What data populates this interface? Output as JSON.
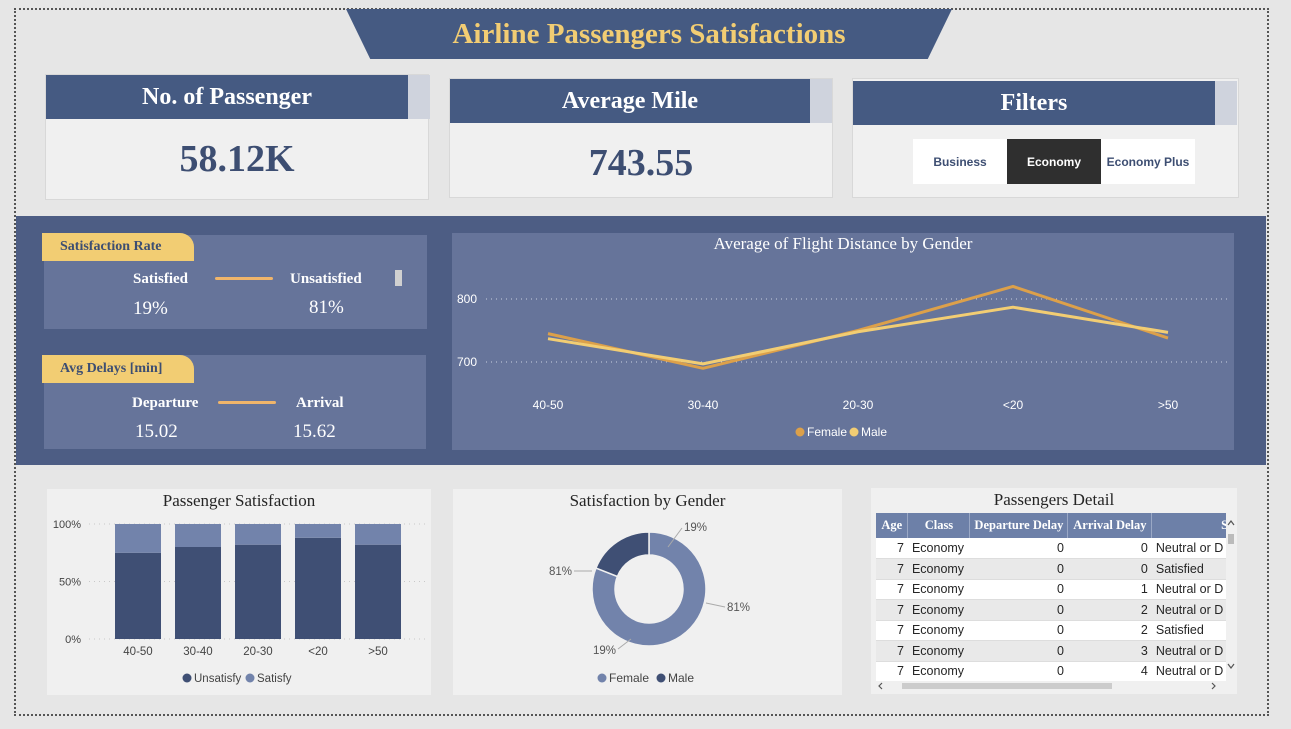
{
  "title": "Airline Passengers Satisfactions",
  "kpis": {
    "passengers": {
      "label": "No. of Passenger",
      "value": "58.12K"
    },
    "mile": {
      "label": "Average Mile",
      "value": "743.55"
    },
    "filters": {
      "label": "Filters",
      "options": [
        "Business",
        "Economy",
        "Economy Plus"
      ],
      "selected": "Economy"
    }
  },
  "satisfaction_rate": {
    "tag": "Satisfaction Rate",
    "left_label": "Satisfied",
    "left_value": "19%",
    "right_label": "Unsatisfied",
    "right_value": "81%"
  },
  "delays": {
    "tag": "Avg Delays [min]",
    "left_label": "Departure",
    "left_value": "15.02",
    "right_label": "Arrival",
    "right_value": "15.62"
  },
  "colors": {
    "navy": "#455a82",
    "gold": "#f2cd73",
    "female": "#dca04a",
    "male": "#f2cd73",
    "unsatisfy": "#3f4f74",
    "satisfy": "#7283ab"
  },
  "chart_data": [
    {
      "type": "line",
      "title": "Average of Flight Distance by Gender",
      "categories": [
        "40-50",
        "30-40",
        "20-30",
        "<20",
        ">50"
      ],
      "yticks": [
        "800",
        "700"
      ],
      "ylim": [
        640,
        860
      ],
      "series": [
        {
          "name": "Female",
          "values": [
            745,
            690,
            750,
            820,
            738
          ]
        },
        {
          "name": "Male",
          "values": [
            737,
            697,
            748,
            787,
            747
          ]
        }
      ],
      "grid": true,
      "legend": "bottom"
    },
    {
      "type": "bar",
      "stacked": true,
      "title": "Passenger Satisfaction",
      "categories": [
        "40-50",
        "30-40",
        "20-30",
        "<20",
        ">50"
      ],
      "yticks": [
        "100%",
        "50%",
        "0%"
      ],
      "ylim": [
        0,
        100
      ],
      "series": [
        {
          "name": "Unsatisfy",
          "values": [
            75,
            80,
            82,
            88,
            82
          ]
        },
        {
          "name": "Satisfy",
          "values": [
            25,
            20,
            18,
            12,
            18
          ]
        }
      ],
      "legend": "bottom"
    },
    {
      "type": "pie",
      "donut": true,
      "title": "Satisfaction by Gender",
      "labels_top": [
        "19%",
        "81%"
      ],
      "labels_bottom": [
        "19%",
        "81%"
      ],
      "slices": [
        {
          "name": "Female",
          "value": 81
        },
        {
          "name": "Male",
          "value": 19
        }
      ],
      "legend_entries": [
        "Female",
        "Male"
      ],
      "legend": "bottom"
    }
  ],
  "detail_table": {
    "title": "Passengers Detail",
    "columns": [
      "Age",
      "Class",
      "Departure Delay",
      "Arrival Delay",
      "Satisfaction"
    ],
    "column_visible_header": [
      "Age",
      "Class",
      "Departure Delay",
      "Arrival Delay",
      "Satisf"
    ],
    "rows": [
      [
        "7",
        "Economy",
        "0",
        "0",
        "Neutral or D"
      ],
      [
        "7",
        "Economy",
        "0",
        "0",
        "Satisfied"
      ],
      [
        "7",
        "Economy",
        "0",
        "1",
        "Neutral or D"
      ],
      [
        "7",
        "Economy",
        "0",
        "2",
        "Neutral or D"
      ],
      [
        "7",
        "Economy",
        "0",
        "2",
        "Satisfied"
      ],
      [
        "7",
        "Economy",
        "0",
        "3",
        "Neutral or D"
      ],
      [
        "7",
        "Economy",
        "0",
        "4",
        "Neutral or D"
      ]
    ]
  },
  "icons": {
    "scroll_up": "chevron-up-icon",
    "scroll_down": "chevron-down-icon",
    "scroll_left": "chevron-left-icon",
    "scroll_right": "chevron-right-icon"
  }
}
